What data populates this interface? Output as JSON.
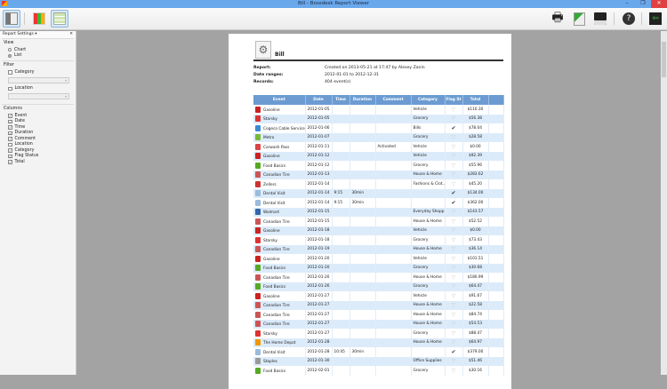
{
  "window": {
    "title": "Bill - Bossdesk Report Viewer",
    "min": "–",
    "max": "❐",
    "close": "✕"
  },
  "toolbar": {
    "left": [
      {
        "icon": "panel-toggle-icon",
        "selected": true
      },
      {
        "icon": "chart-view-icon",
        "selected": false
      },
      {
        "icon": "list-view-icon",
        "selected": true
      }
    ],
    "right": [
      "print-icon",
      "export-excel-icon",
      "save-icon",
      "help-icon",
      "exit-icon"
    ]
  },
  "panel": {
    "title": "Report Settings ▾",
    "close": "✕",
    "view": {
      "label": "View",
      "options": [
        "Chart",
        "List"
      ],
      "selected": "List"
    },
    "filter": {
      "label": "Filter",
      "category": "Category",
      "location": "Location"
    },
    "columns": {
      "label": "Columns",
      "items": [
        {
          "label": "Event",
          "checked": true
        },
        {
          "label": "Date",
          "checked": true
        },
        {
          "label": "Time",
          "checked": true
        },
        {
          "label": "Duration",
          "checked": true
        },
        {
          "label": "Comment",
          "checked": true
        },
        {
          "label": "Location",
          "checked": false
        },
        {
          "label": "Category",
          "checked": true
        },
        {
          "label": "Flag Status",
          "checked": true
        },
        {
          "label": "Total",
          "checked": true
        }
      ]
    }
  },
  "report": {
    "title": "Bill",
    "report_label": "Report:",
    "report_value": "Created on 2013-05-21 at 17:47 by Alexey Zanin",
    "range_label": "Date ranges:",
    "range_value": "2012-01-01 to 2012-12-31",
    "records_label": "Records:",
    "records_value": "404 event(s)",
    "headers": [
      "Event",
      "Date",
      "Time",
      "Duration",
      "Comment",
      "Category",
      "Flag St",
      "Total",
      ""
    ],
    "rows": [
      [
        "Gasoline",
        "2012-01-05",
        "",
        "",
        "",
        "Vehicle",
        false,
        "$110.30"
      ],
      [
        "Starsky",
        "2012-01-05",
        "",
        "",
        "",
        "Grocery",
        false,
        "$56.38"
      ],
      [
        "Cogeco Cable Service",
        "2012-01-06",
        "",
        "",
        "",
        "Bills",
        true,
        "$78.04"
      ],
      [
        "Metro",
        "2012-01-07",
        "",
        "",
        "",
        "Grocery",
        false,
        "$28.58"
      ],
      [
        "Carwash Pass",
        "2012-01-11",
        "",
        "",
        "Activated",
        "Vehicle",
        false,
        "$0.00"
      ],
      [
        "Gasoline",
        "2012-01-12",
        "",
        "",
        "",
        "Vehicle",
        false,
        "$92.39"
      ],
      [
        "Food Basics",
        "2012-01-12",
        "",
        "",
        "",
        "Grocery",
        false,
        "$55.96"
      ],
      [
        "Canadian Tire",
        "2012-01-13",
        "",
        "",
        "",
        "House & Home",
        false,
        "$283.62"
      ],
      [
        "Zellers",
        "2012-01-14",
        "",
        "",
        "",
        "Fashions & Clot...",
        false,
        "$45.20"
      ],
      [
        "Dental Visit",
        "2012-01-14",
        "9:15",
        "30min",
        "",
        "",
        true,
        "$134.00"
      ],
      [
        "Dental Visit",
        "2012-01-14",
        "9:15",
        "30min",
        "",
        "",
        true,
        "$362.00"
      ],
      [
        "Walmart",
        "2012-01-15",
        "",
        "",
        "",
        "Everyday Shopp...",
        false,
        "$143.57"
      ],
      [
        "Canadian Tire",
        "2012-01-15",
        "",
        "",
        "",
        "House & Home",
        false,
        "$52.52"
      ],
      [
        "Gasoline",
        "2012-01-18",
        "",
        "",
        "",
        "Vehicle",
        false,
        "$0.00"
      ],
      [
        "Starsky",
        "2012-01-18",
        "",
        "",
        "",
        "Grocery",
        false,
        "$73.43"
      ],
      [
        "Canadian Tire",
        "2012-01-19",
        "",
        "",
        "",
        "House & Home",
        false,
        "$36.14"
      ],
      [
        "Gasoline",
        "2012-01-20",
        "",
        "",
        "",
        "Vehicle",
        false,
        "$101.51"
      ],
      [
        "Food Basics",
        "2012-01-20",
        "",
        "",
        "",
        "Grocery",
        false,
        "$30.68"
      ],
      [
        "Canadian Tire",
        "2012-01-20",
        "",
        "",
        "",
        "House & Home",
        false,
        "$180.99"
      ],
      [
        "Food Basics",
        "2012-01-26",
        "",
        "",
        "",
        "Grocery",
        false,
        "$64.47"
      ],
      [
        "Gasoline",
        "2012-01-27",
        "",
        "",
        "",
        "Vehicle",
        false,
        "$91.67"
      ],
      [
        "Canadian Tire",
        "2012-01-27",
        "",
        "",
        "",
        "House & Home",
        false,
        "$22.58"
      ],
      [
        "Canadian Tire",
        "2012-01-27",
        "",
        "",
        "",
        "House & Home",
        false,
        "$84.74"
      ],
      [
        "Canadian Tire",
        "2012-01-27",
        "",
        "",
        "",
        "House & Home",
        false,
        "$54.53"
      ],
      [
        "Starsky",
        "2012-01-27",
        "",
        "",
        "",
        "Grocery",
        false,
        "$88.47"
      ],
      [
        "The Home Depot",
        "2012-01-28",
        "",
        "",
        "",
        "House & Home",
        false,
        "$64.97"
      ],
      [
        "Dental Visit",
        "2012-01-28",
        "10:45",
        "30min",
        "",
        "",
        true,
        "$379.00"
      ],
      [
        "Staples",
        "2012-01-30",
        "",
        "",
        "",
        "Office Supplies",
        false,
        "$51.46"
      ],
      [
        "Food Basics",
        "2012-02-01",
        "",
        "",
        "",
        "Grocery",
        false,
        "$30.16"
      ]
    ]
  },
  "colors": {
    "titlebar": "#6aa8ec",
    "header": "#6b9bd1",
    "alt_row": "#dcebfa"
  }
}
